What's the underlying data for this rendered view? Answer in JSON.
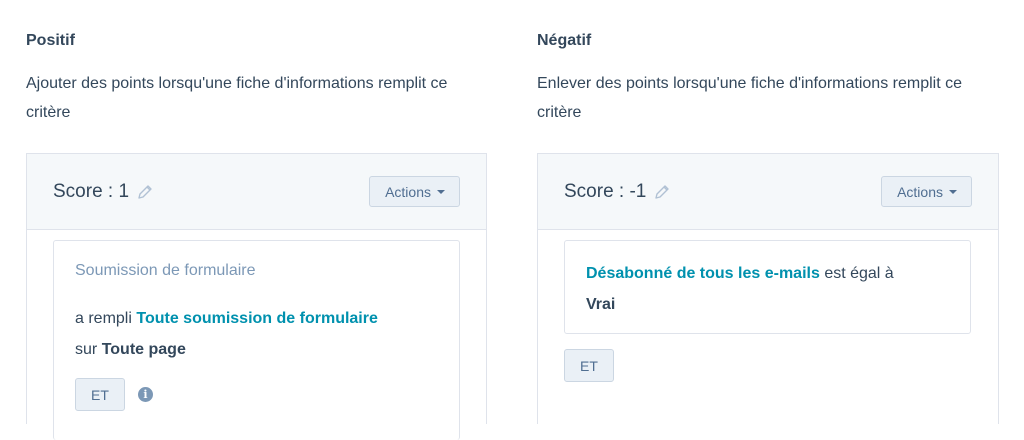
{
  "positive": {
    "title": "Positif",
    "description": "Ajouter des points lorsqu'une fiche d'informations remplit ce critère",
    "score": "Score : 1",
    "actions_label": "Actions",
    "card": {
      "subtitle": "Soumission de formulaire",
      "prefix": "a rempli",
      "link": "Toute soumission de formulaire",
      "mid": "sur",
      "target": "Toute page"
    },
    "and_label": "ET",
    "info_glyph": "i"
  },
  "negative": {
    "title": "Négatif",
    "description": "Enlever des points lorsqu'une fiche d'informations remplit ce critère",
    "score": "Score : -1",
    "actions_label": "Actions",
    "card": {
      "link": "Désabonné de tous les e-mails",
      "mid": "est égal à",
      "value": "Vrai"
    },
    "and_label": "ET"
  },
  "colors": {
    "text": "#33475b",
    "link": "#0091ae",
    "muted": "#7c98b6",
    "panel_bg": "#f5f8fa",
    "border": "#dfe3eb",
    "button_bg": "#eaf0f6"
  },
  "icons": {
    "edit": "pencil-icon",
    "dropdown": "caret-down-icon",
    "info": "info-icon"
  }
}
